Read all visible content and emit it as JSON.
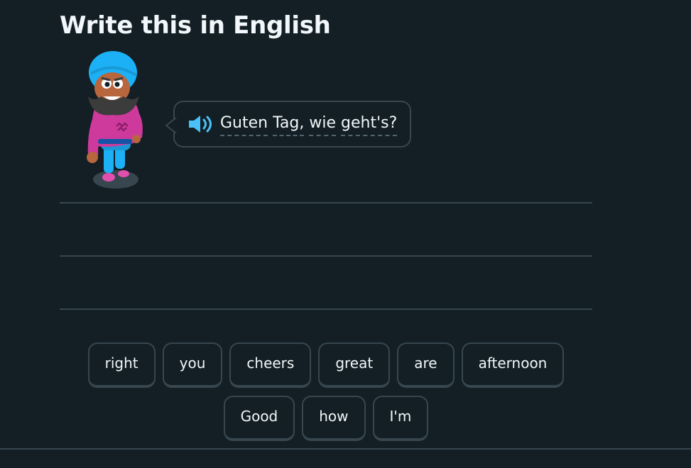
{
  "header": {
    "title": "Write this in English"
  },
  "prompt": {
    "speaker_icon": "speaker-icon",
    "words": [
      "Guten",
      "Tag,",
      "wie",
      "geht's?"
    ]
  },
  "word_bank": {
    "row1": [
      "right",
      "you",
      "cheers",
      "great",
      "are",
      "afternoon"
    ],
    "row2": [
      "Good",
      "how",
      "I'm"
    ]
  },
  "colors": {
    "background": "#131f24",
    "border": "#37464f",
    "accent_blue": "#49c0f8",
    "text": "#f1f7fb"
  }
}
